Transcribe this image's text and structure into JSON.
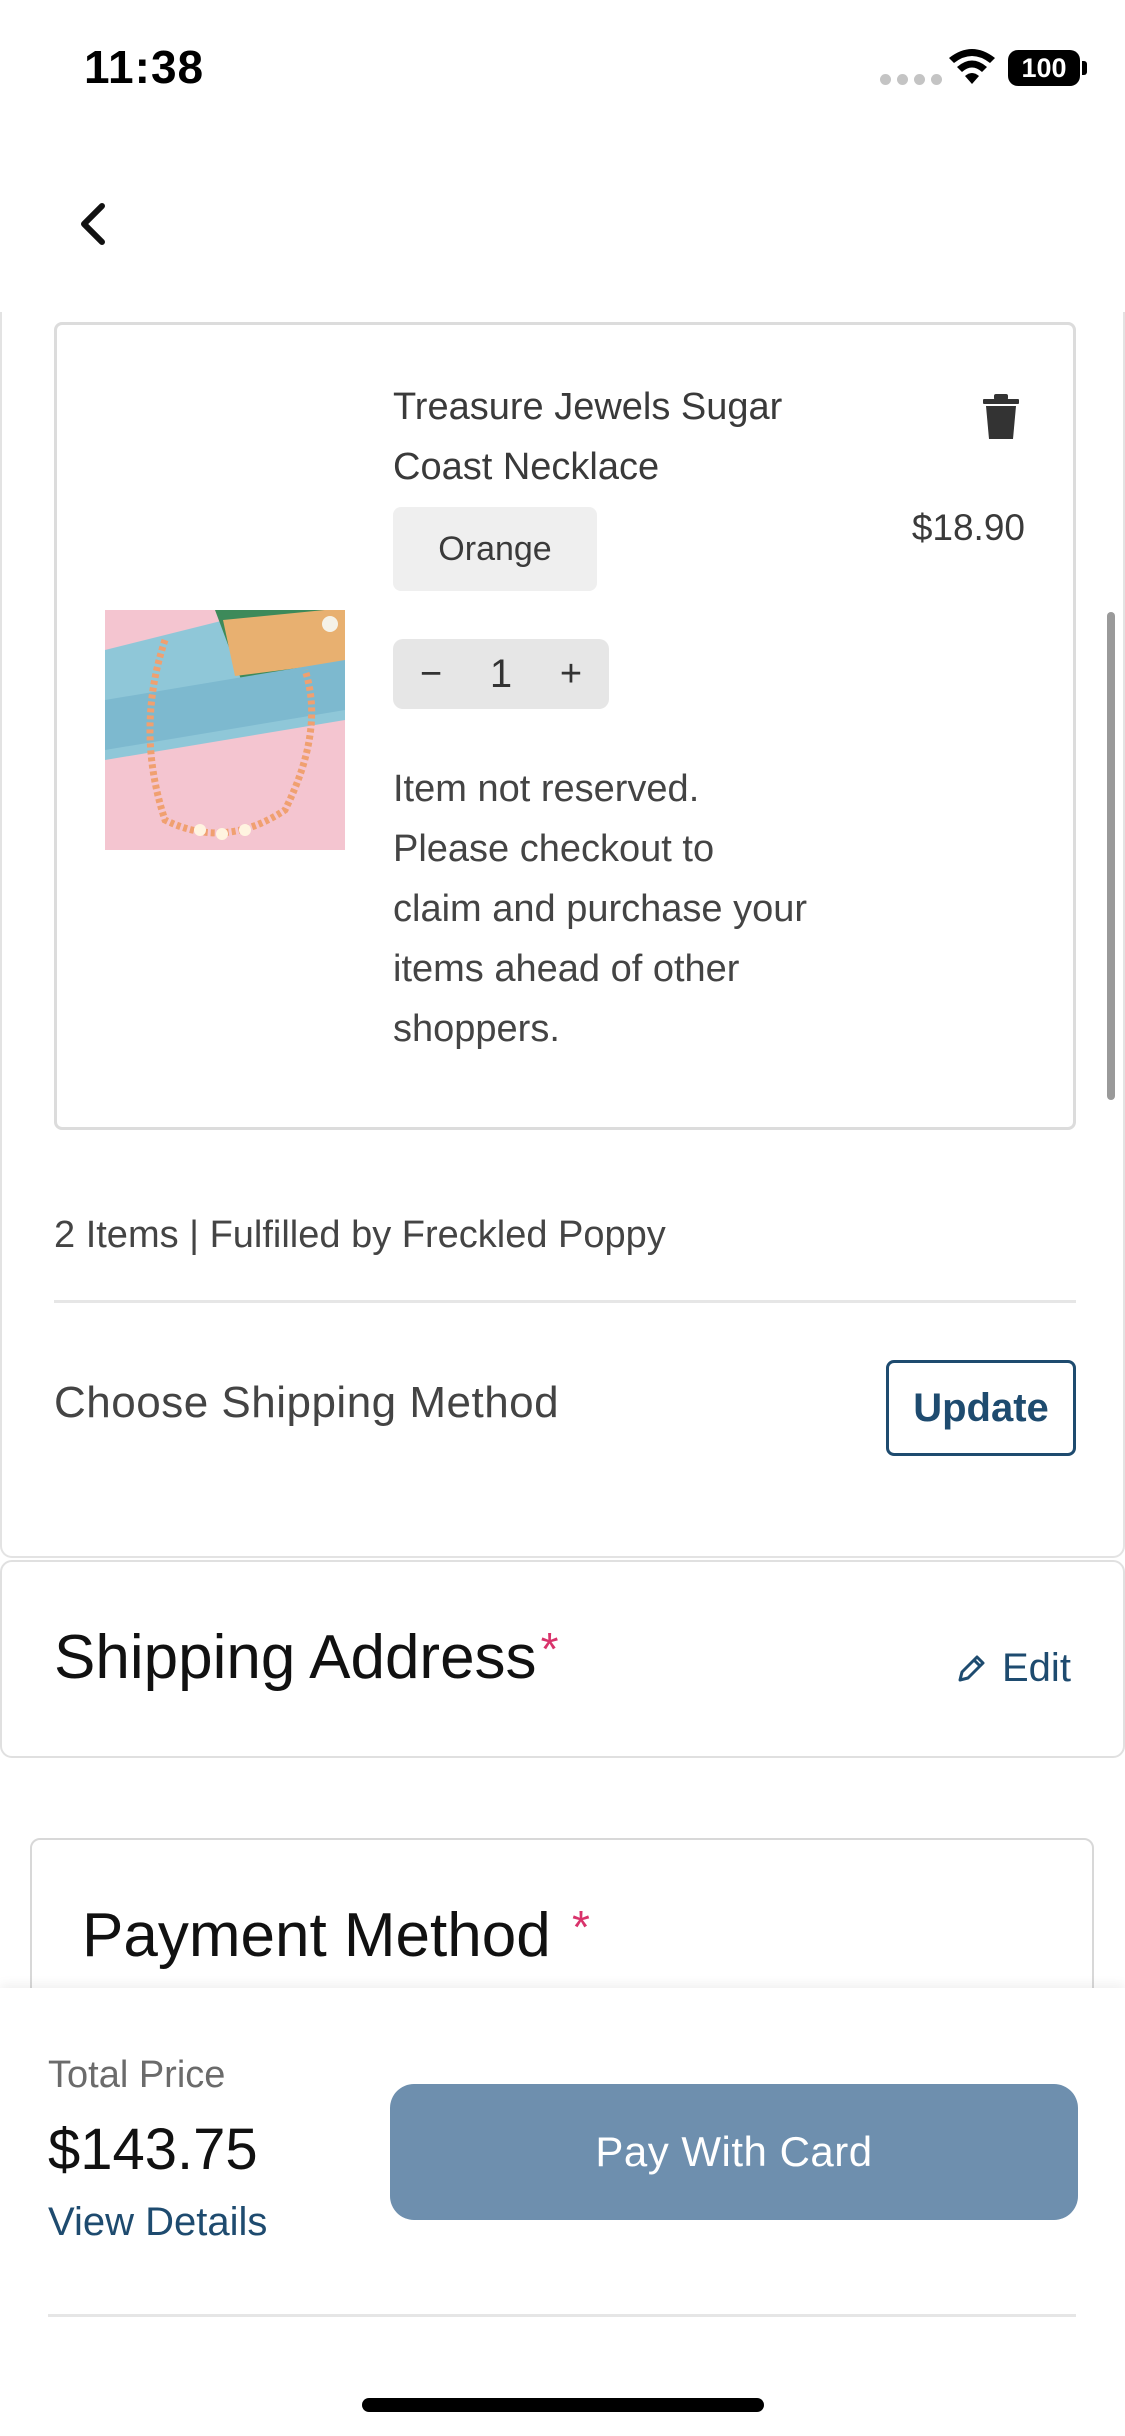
{
  "status_bar": {
    "time": "11:38",
    "battery": "100",
    "icons": [
      "signal-dots-icon",
      "wifi-icon",
      "battery-icon"
    ]
  },
  "nav": {
    "back_icon": "chevron-left-icon"
  },
  "cart_item": {
    "title": "Treasure Jewels Sugar Coast Necklace",
    "variant": "Orange",
    "price": "$18.90",
    "quantity": "1",
    "decrement_label": "−",
    "increment_label": "+",
    "delete_icon": "trash-icon",
    "note": "Item not reserved. Please checkout to claim and purchase your items ahead of other shoppers."
  },
  "summary": {
    "items_text": "2 Items | Fulfilled by Freckled Poppy"
  },
  "shipping_method": {
    "label": "Choose Shipping Method",
    "update_label": "Update"
  },
  "shipping_address": {
    "title": "Shipping Address",
    "required_marker": "*",
    "edit_label": "Edit",
    "edit_icon": "pencil-icon"
  },
  "payment_method": {
    "title": "Payment Method",
    "required_marker": "*"
  },
  "checkout": {
    "total_label": "Total Price",
    "total_value": "$143.75",
    "view_details_label": "View Details",
    "pay_label": "Pay With Card"
  },
  "colors": {
    "accent": "#1e4b6f",
    "pay_button": "#6e8fae",
    "required": "#d9336b"
  }
}
